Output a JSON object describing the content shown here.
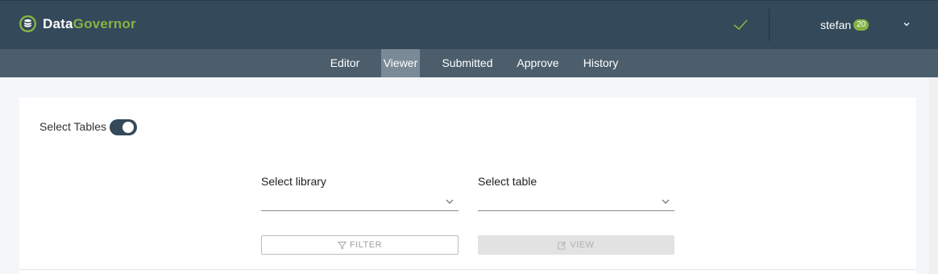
{
  "header": {
    "brand_part1": "Data",
    "brand_part2": "Governor",
    "username": "stefan",
    "badge_count": "20",
    "icons": {
      "logo": "database-logo-icon",
      "status": "check-icon",
      "user_menu": "chevron-down-icon"
    },
    "colors": {
      "header_bg": "#34495a",
      "nav_bg": "#4c5e6c",
      "accent": "#84b443"
    }
  },
  "nav": {
    "items": [
      {
        "label": "Editor",
        "active": false
      },
      {
        "label": "Viewer",
        "active": true
      },
      {
        "label": "Submitted",
        "active": false
      },
      {
        "label": "Approve",
        "active": false
      },
      {
        "label": "History",
        "active": false
      }
    ]
  },
  "main": {
    "toggle_label": "Select Tables",
    "toggle_on": true,
    "library_label": "Select library",
    "library_value": "",
    "table_label": "Select table",
    "table_value": "",
    "filter_label": "FILTER",
    "view_label": "VIEW",
    "icons": {
      "filter": "filter-icon",
      "view": "edit-icon",
      "select": "chevron-down-icon"
    }
  }
}
